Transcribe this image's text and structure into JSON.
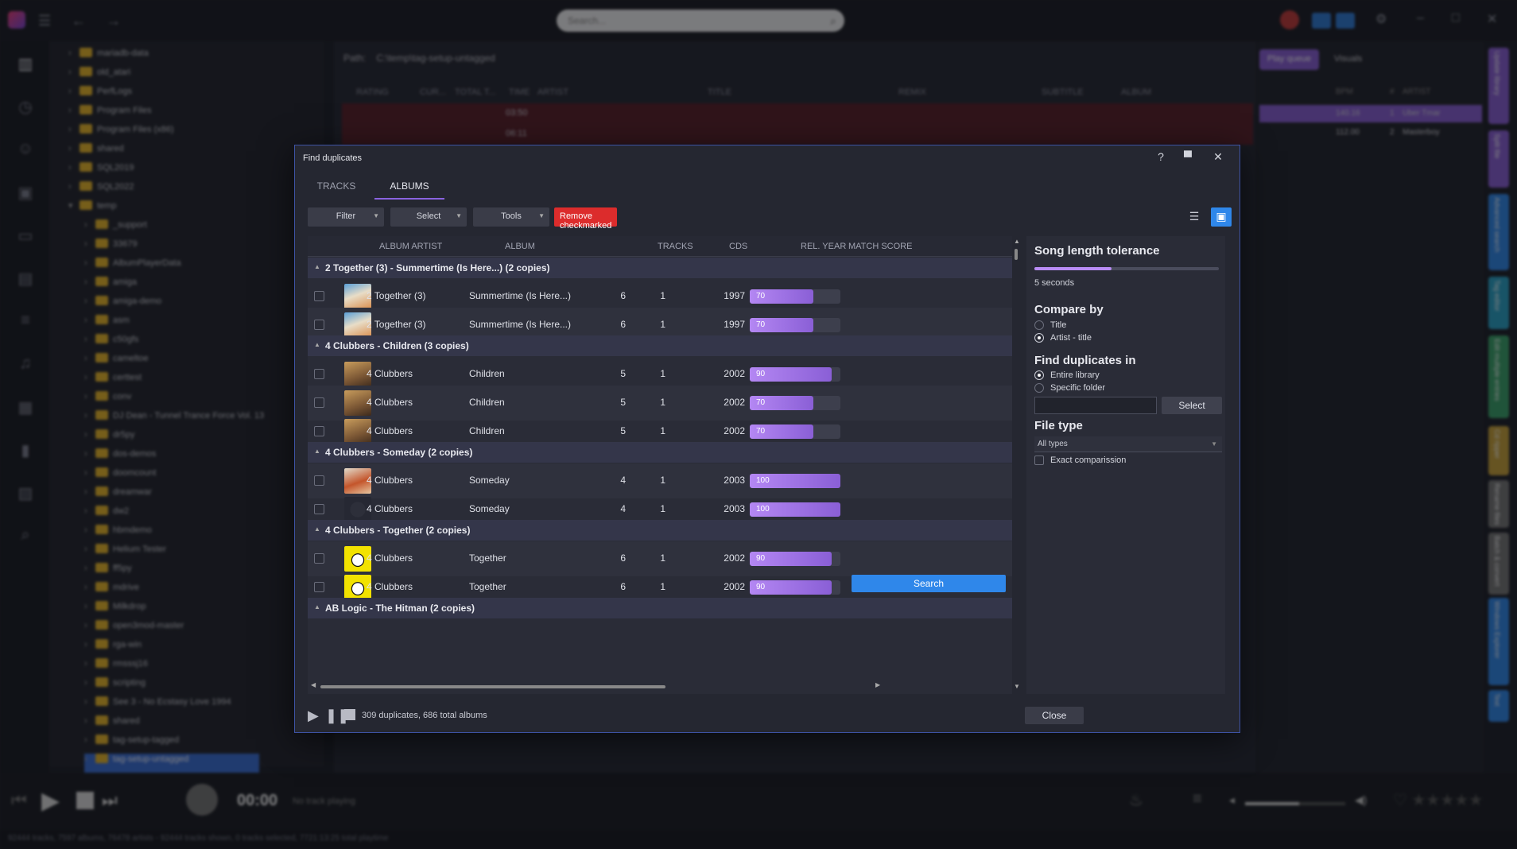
{
  "app": {
    "search_placeholder": "Search...",
    "path_label": "Path:",
    "path_value": "C:\\temp\\tag-setup-untagged",
    "columns": [
      "RATING",
      "CUR...",
      "TOTAL T...",
      "TIME",
      "ARTIST",
      "TITLE",
      "REMIX",
      "SUBTITLE",
      "ALBUM"
    ],
    "times": [
      "03:50",
      "06:11"
    ],
    "tree": [
      "mariadb-data",
      "old_atari",
      "PerfLogs",
      "Program Files",
      "Program Files (x86)",
      "shared",
      "SQL2019",
      "SQL2022",
      "temp",
      "_support",
      "33679",
      "AlbumPlayerData",
      "amiga",
      "amiga-demo",
      "asm",
      "c50gfs",
      "cameltoe",
      "certtest",
      "conv",
      "DJ Dean - Tunnel Trance Force Vol. 13",
      "dr5py",
      "dos-demos",
      "doomcount",
      "dreamwar",
      "dw2",
      "hbmdemo",
      "Helium Tester",
      "ff5py",
      "mdrive",
      "Milkdrop",
      "open3mod-master",
      "rga-win",
      "rmsssj16",
      "scripting",
      "See 3 - No Ecstasy Love 1994",
      "shared",
      "tag-setup-tagged",
      "tag-setup-untagged"
    ],
    "right_tabs": [
      "Play queue",
      "Visuals"
    ],
    "queue_header": [
      "BPM",
      "#",
      "ARTIST"
    ],
    "queue": [
      {
        "bpm": "140.16",
        "num": "1",
        "artist": "Uber Tmar"
      },
      {
        "bpm": "112.00",
        "num": "2",
        "artist": "Masterboy"
      }
    ],
    "side_tabs": [
      "Update library",
      "Split file",
      "Advanced search",
      "Tag editor",
      "Edit multiple entries",
      "Cd ripper",
      "Rename files",
      "Batch & convert",
      "Windows Explorer",
      "Text"
    ],
    "player": {
      "time": "00:00",
      "status": "No track playing"
    },
    "statusbar": "92444 tracks, 7597 albums, 76478 artists - 92444 tracks shown, 0 tracks selected, 7721:13:25 total playtime"
  },
  "dialog": {
    "title": "Find duplicates",
    "tabs": [
      "TRACKS",
      "ALBUMS"
    ],
    "active_tab": 1,
    "toolbar": {
      "filter": "Filter",
      "select": "Select",
      "tools": "Tools",
      "remove": "Remove checkmarked"
    },
    "columns": {
      "album_artist": "ALBUM ARTIST",
      "album": "ALBUM",
      "tracks": "TRACKS",
      "cds": "CDS",
      "rel_year": "REL. YEAR",
      "match": "MATCH SCORE"
    },
    "groups": [
      {
        "label": "2 Together (3) - Summertime (Is Here...) (2 copies)",
        "rows": [
          {
            "artist": "2 Together (3)",
            "album": "Summertime (Is Here...)",
            "tracks": "6",
            "cds": "1",
            "year": "1997",
            "score": 70,
            "score_label": "70",
            "thumb": "summer"
          },
          {
            "artist": "2 Together (3)",
            "album": "Summertime (Is Here...)",
            "tracks": "6",
            "cds": "1",
            "year": "1997",
            "score": 70,
            "score_label": "70",
            "thumb": "summer"
          }
        ]
      },
      {
        "label": "4 Clubbers - Children (3 copies)",
        "rows": [
          {
            "artist": "4 Clubbers",
            "album": "Children",
            "tracks": "5",
            "cds": "1",
            "year": "2002",
            "score": 90,
            "score_label": "90",
            "thumb": "children"
          },
          {
            "artist": "4 Clubbers",
            "album": "Children",
            "tracks": "5",
            "cds": "1",
            "year": "2002",
            "score": 70,
            "score_label": "70",
            "thumb": "children"
          },
          {
            "artist": "4 Clubbers",
            "album": "Children",
            "tracks": "5",
            "cds": "1",
            "year": "2002",
            "score": 70,
            "score_label": "70",
            "thumb": "children"
          }
        ]
      },
      {
        "label": "4 Clubbers - Someday (2 copies)",
        "rows": [
          {
            "artist": "4 Clubbers",
            "album": "Someday",
            "tracks": "4",
            "cds": "1",
            "year": "2003",
            "score": 100,
            "score_label": "100",
            "thumb": "someday"
          },
          {
            "artist": "4 Clubbers",
            "album": "Someday",
            "tracks": "4",
            "cds": "1",
            "year": "2003",
            "score": 100,
            "score_label": "100",
            "thumb": "none"
          }
        ]
      },
      {
        "label": "4 Clubbers - Together (2 copies)",
        "rows": [
          {
            "artist": "4 Clubbers",
            "album": "Together",
            "tracks": "6",
            "cds": "1",
            "year": "2002",
            "score": 90,
            "score_label": "90",
            "thumb": "together"
          },
          {
            "artist": "4 Clubbers",
            "album": "Together",
            "tracks": "6",
            "cds": "1",
            "year": "2002",
            "score": 90,
            "score_label": "90",
            "thumb": "together"
          }
        ]
      },
      {
        "label": "AB Logic - The Hitman (2 copies)",
        "rows": []
      }
    ],
    "side": {
      "tolerance_title": "Song length tolerance",
      "tolerance_value": "5 seconds",
      "tolerance_fraction": 0.42,
      "compare_title": "Compare by",
      "compare_options": [
        "Title",
        "Artist - title"
      ],
      "compare_selected": 1,
      "find_title": "Find duplicates in",
      "find_options": [
        "Entire library",
        "Specific folder"
      ],
      "find_selected": 0,
      "folder_value": "",
      "select_label": "Select",
      "filetype_title": "File type",
      "filetype_value": "All types",
      "exact_label": "Exact comparission",
      "exact_checked": false,
      "search_label": "Search"
    },
    "footer": {
      "status": "309 duplicates, 686 total albums",
      "close": "Close"
    }
  }
}
